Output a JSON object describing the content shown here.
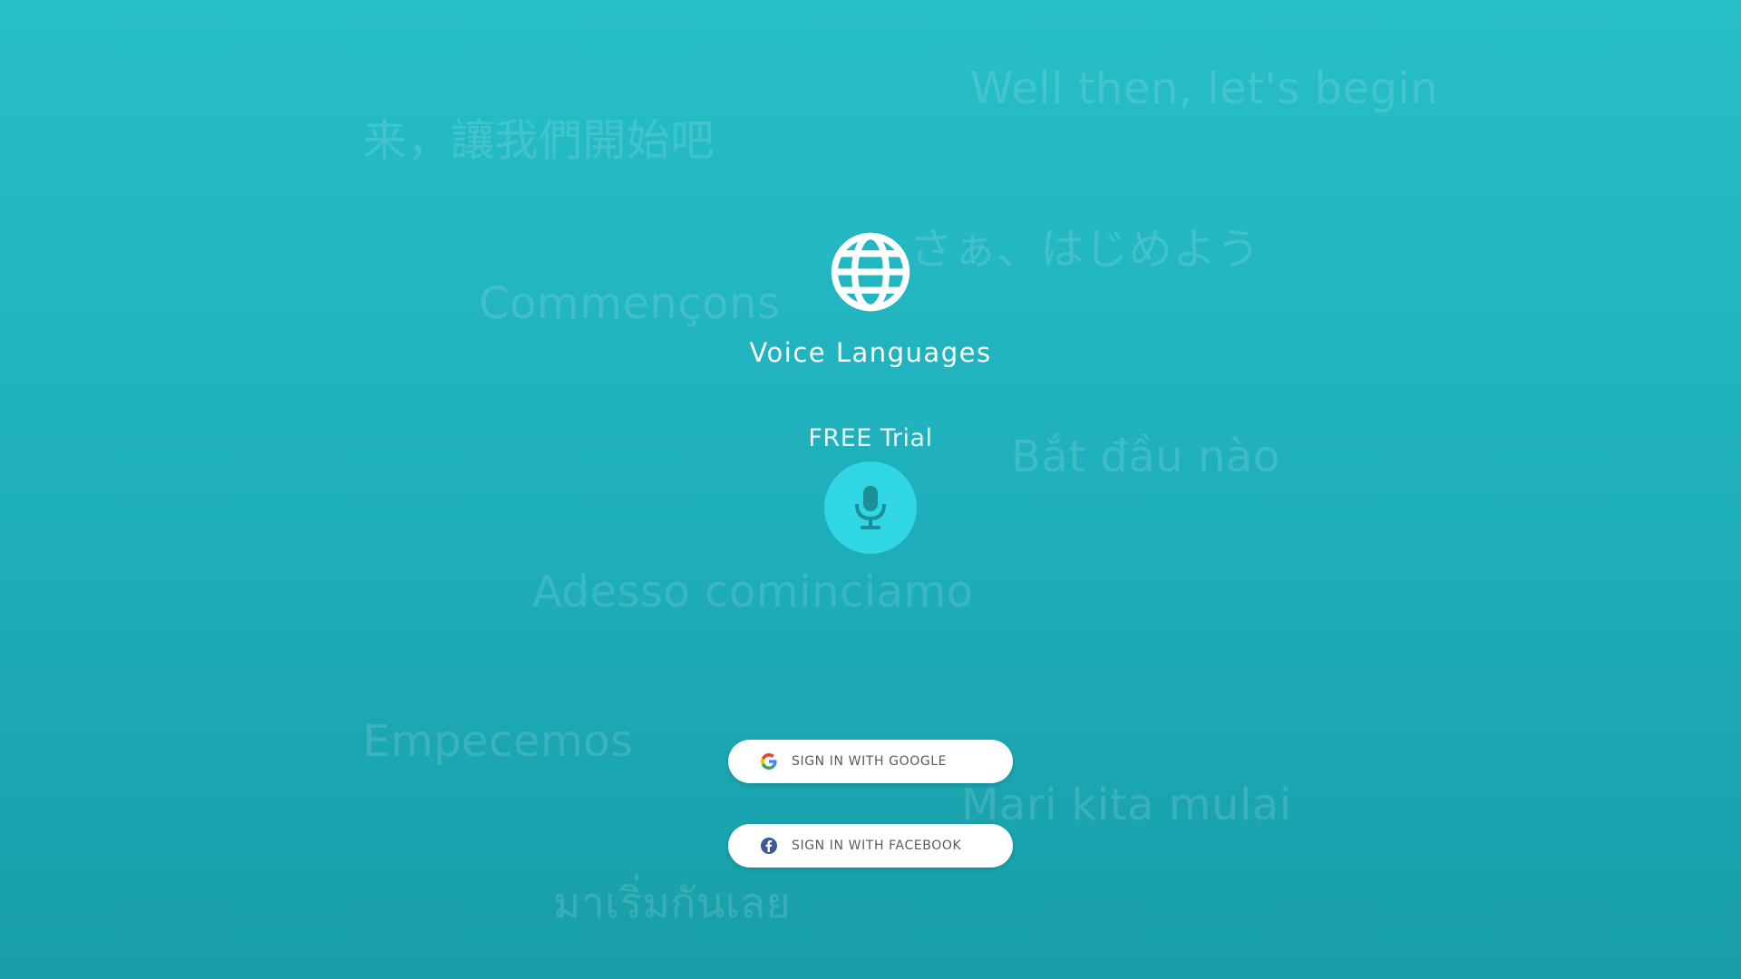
{
  "app": {
    "title": "Voice Languages",
    "logo_icon": "globe-icon"
  },
  "trial": {
    "label": "FREE Trial",
    "button_icon": "microphone-icon"
  },
  "background_phrases": {
    "english": "Well then, let's begin",
    "chinese": "来，讓我們開始吧",
    "japanese": "さぁ、はじめよう",
    "french": "Commençons",
    "vietnamese": "Bắt đầu nào",
    "italian": "Adesso cominciamo",
    "spanish": "Empecemos",
    "indonesian": "Mari kita mulai",
    "thai": "มาเริ่มกันเลย"
  },
  "signin": {
    "google_label": "SIGN IN WITH GOOGLE",
    "facebook_label": "SIGN IN WITH FACEBOOK"
  },
  "colors": {
    "background_top": "#27bfc7",
    "background_bottom": "#189ea8",
    "mic_button": "#31d6e4",
    "facebook_blue": "#3b5998"
  }
}
